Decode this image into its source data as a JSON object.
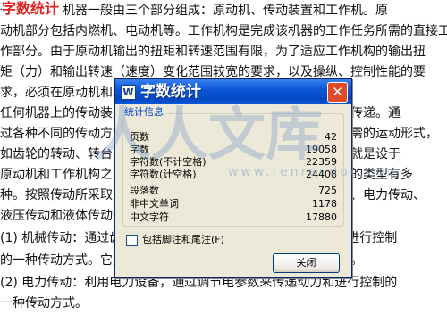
{
  "document": {
    "label": "字数统计",
    "lines": [
      "一般而言，机器一般由三个部分组成：原动机、传动装置和工作机。原",
      "动机部分包括内燃机、电动机等。工作机构是完成该机器的工作任务所需的直接工",
      "作部分。由于原动机输出的扭矩和转速范围有限，为了适应工作机构的输出扭",
      "矩（力）和输出转速（速度）变化范围较宽的要求，以及操纵、控制性能的要",
      "求，必须在原动机和工作机构之间加入传动装置。",
      "    任何机器上的传动装置，都是用来传递运动和动力的，即机构的传递。通",
      "过各种不同的传动方式，可以将原动机的运动转换为工作机构所需的运动形式，",
      "如齿轮的转动、转台的回转、以及丝杆的直线运动等。传动装置就是设于",
      "原动机和工作机构之间，用来传递运动和动力的装置。传动机构的类型有多",
      "种。按照传动所采取的机件或工作介质的不同，可分为机械传动、电力传动、",
      "液压传动和液体传动等。",
      "    (1) 机械传动：通过齿轮、皮带、链条等机件传递运动和动力和进行控制",
      "的一种传动方式。它是实现各种机械运动最基本的一种传动方式。",
      "    (2) 电力传动：利用电力设备，通过调节电参数来传递动力和进行控制的",
      "一种传动方式。"
    ]
  },
  "watermark": {
    "text": "人人文库",
    "url": "www.renrendoc.com"
  },
  "dialog": {
    "title": "字数统计",
    "title_icon": "W",
    "close_glyph": "✕",
    "group_title": "统计信息",
    "stats": [
      {
        "label": "页数",
        "value": "42"
      },
      {
        "label": "字数",
        "value": "19058"
      },
      {
        "label": "字符数(不计空格)",
        "value": "22359"
      },
      {
        "label": "字符数(计空格)",
        "value": "24408"
      },
      {
        "label": "段落数",
        "value": "725"
      },
      {
        "label": "非中文单词",
        "value": "1178"
      },
      {
        "label": "中文字符",
        "value": "17880"
      }
    ],
    "checkbox_label": "包括脚注和尾注(F)",
    "checkbox_checked": false,
    "close_button_label": "关闭"
  },
  "colors": {
    "titlebar": "#0a58d6",
    "dialog_bg": "#ece9d8",
    "close_button": "#e04a28",
    "doc_label": "#e02020",
    "group_title": "#0046d5"
  },
  "icons": {
    "title_icon": "word-app-icon",
    "close_icon": "close-icon"
  }
}
